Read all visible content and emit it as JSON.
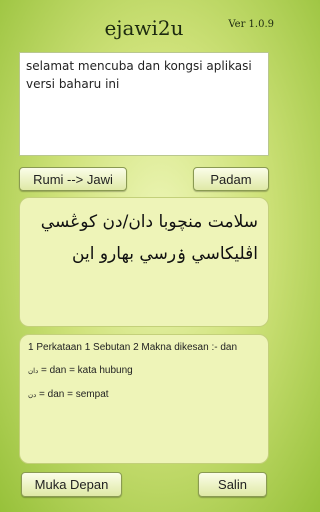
{
  "app": {
    "title": "ejawi2u",
    "version": "Ver 1.0.9"
  },
  "input": {
    "text": "selamat mencuba dan kongsi aplikasi versi baharu ini"
  },
  "buttons": {
    "convert": "Rumi --> Jawi",
    "clear": "Padam",
    "home": "Muka Depan",
    "copy": "Salin"
  },
  "output": {
    "line1": "سلامت منچوبا دان/دن كوڠسي",
    "line2": "اڤليكاسي ۏرسي بهارو اين"
  },
  "meaning": {
    "header": "1 Perkataan 1 Sebutan 2 Makna dikesan :- dan",
    "items": [
      {
        "jawi": "دان",
        "text": "= dan = kata hubung"
      },
      {
        "jawi": "دن",
        "text": "= dan = sempat"
      }
    ]
  }
}
